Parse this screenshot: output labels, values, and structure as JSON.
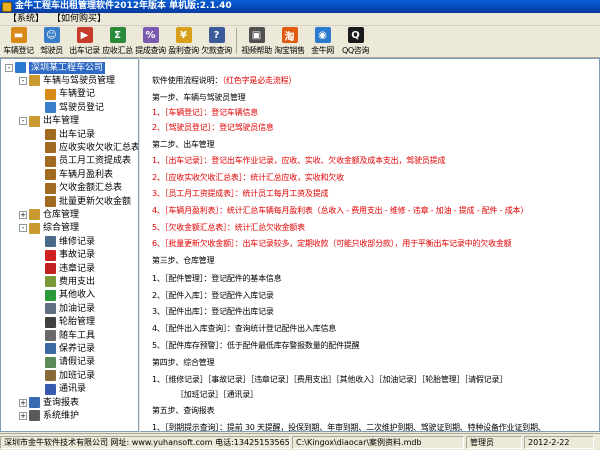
{
  "window": {
    "title": "金牛工程车出租管理软件2012年版本 单机版:2.1.40"
  },
  "menu": [
    "【系统】",
    "【如何购买】"
  ],
  "toolbar": [
    {
      "label": "车辆登记",
      "icon": "truck-icon",
      "color": "#d88a18"
    },
    {
      "label": "驾驶员",
      "icon": "driver-icon",
      "color": "#3a7dc8"
    },
    {
      "label": "出车记录",
      "icon": "dispatch-icon",
      "color": "#c83a2a"
    },
    {
      "label": "应收汇总",
      "icon": "summary-icon",
      "color": "#2a8a3a"
    },
    {
      "label": "提成查询",
      "icon": "commission-icon",
      "color": "#7a5ab0"
    },
    {
      "label": "盈利查询",
      "icon": "profit-icon",
      "color": "#d8a018"
    },
    {
      "label": "欠款查询",
      "icon": "debt-icon",
      "color": "#3a5a9a"
    },
    {
      "label": "视频帮助",
      "icon": "video-icon",
      "color": "#505050"
    },
    {
      "label": "淘宝销售",
      "icon": "taobao-icon",
      "color": "#e05a10"
    },
    {
      "label": "金牛网",
      "icon": "globe-icon",
      "color": "#2a7ad0"
    },
    {
      "label": "QQ咨询",
      "icon": "qq-icon",
      "color": "#1a1a1a"
    }
  ],
  "tree": [
    {
      "label": "深圳某工程车公司",
      "level": 0,
      "icon": "company-icon",
      "color": "#2a7ad0",
      "exp": "-",
      "selected": true
    },
    {
      "label": "车辆与驾驶员管理",
      "level": 1,
      "icon": "folder-icon",
      "color": "#c89a30",
      "exp": "-"
    },
    {
      "label": "车辆登记",
      "level": 2,
      "icon": "truck-icon",
      "color": "#d88a18"
    },
    {
      "label": "驾驶员登记",
      "level": 2,
      "icon": "driver-icon",
      "color": "#3a7dc8"
    },
    {
      "label": "出车管理",
      "level": 1,
      "icon": "folder-icon",
      "color": "#c89a30",
      "exp": "-"
    },
    {
      "label": "出车记录",
      "level": 2,
      "icon": "doc-icon",
      "color": "#a06a20"
    },
    {
      "label": "应收实收欠收汇总表",
      "level": 2,
      "icon": "doc-icon",
      "color": "#a06a20"
    },
    {
      "label": "员工月工资提成表",
      "level": 2,
      "icon": "doc-icon",
      "color": "#a06a20"
    },
    {
      "label": "车辆月盈利表",
      "level": 2,
      "icon": "doc-icon",
      "color": "#a06a20"
    },
    {
      "label": "欠收金额汇总表",
      "level": 2,
      "icon": "doc-icon",
      "color": "#a06a20"
    },
    {
      "label": "批量更新欠收金额",
      "level": 2,
      "icon": "doc-icon",
      "color": "#a06a20"
    },
    {
      "label": "仓库管理",
      "level": 1,
      "icon": "folder-icon",
      "color": "#c89a30",
      "exp": "+"
    },
    {
      "label": "综合管理",
      "level": 1,
      "icon": "folder-icon",
      "color": "#c89a30",
      "exp": "-"
    },
    {
      "label": "维修记录",
      "level": 2,
      "icon": "wrench-icon",
      "color": "#4a6a8a"
    },
    {
      "label": "事故记录",
      "level": 2,
      "icon": "accident-icon",
      "color": "#d02020"
    },
    {
      "label": "违章记录",
      "level": 2,
      "icon": "violation-icon",
      "color": "#c02020"
    },
    {
      "label": "费用支出",
      "level": 2,
      "icon": "expense-icon",
      "color": "#7a9a3a"
    },
    {
      "label": "其他收入",
      "level": 2,
      "icon": "income-icon",
      "color": "#2a9a3a"
    },
    {
      "label": "加油记录",
      "level": 2,
      "icon": "fuel-icon",
      "color": "#607080"
    },
    {
      "label": "轮胎管理",
      "level": 2,
      "icon": "tire-icon",
      "color": "#404040"
    },
    {
      "label": "随车工具",
      "level": 2,
      "icon": "tool-icon",
      "color": "#6a6a6a"
    },
    {
      "label": "保养记录",
      "level": 2,
      "icon": "gear-icon",
      "color": "#3a6aa0"
    },
    {
      "label": "请假记录",
      "level": 2,
      "icon": "leave-icon",
      "color": "#5a8a5a"
    },
    {
      "label": "加班记录",
      "level": 2,
      "icon": "overtime-icon",
      "color": "#8a6a3a"
    },
    {
      "label": "通讯录",
      "level": 2,
      "icon": "contacts-icon",
      "color": "#3a5ab0"
    },
    {
      "label": "查询报表",
      "level": 1,
      "icon": "report-icon",
      "color": "#3a6ab0",
      "exp": "+"
    },
    {
      "label": "系统维护",
      "level": 1,
      "icon": "system-icon",
      "color": "#5a5a5a",
      "exp": "+"
    }
  ],
  "content": {
    "lines": [
      {
        "segments": [
          {
            "t": "软件使用流程说明：",
            "c": ""
          },
          {
            "t": "（红色字是必走流程）",
            "c": "red"
          }
        ],
        "indent": 0
      },
      {
        "segments": [
          {
            "t": "第一步、车辆与驾驶员管理",
            "c": ""
          }
        ],
        "indent": 0
      },
      {
        "segments": [
          {
            "t": "1、［车辆登记］：登记车辆信息",
            "c": "red"
          }
        ],
        "indent": 0
      },
      {
        "segments": [
          {
            "t": "2、［驾驶员登记］：登记驾驶员信息",
            "c": "red"
          }
        ],
        "indent": 0
      },
      {
        "segments": [
          {
            "t": "第二步、出车管理",
            "c": ""
          }
        ],
        "indent": 0
      },
      {
        "segments": [
          {
            "t": "1、［出车记录］：登记出车作业记录，应收、实收、欠收金额及成本支出，驾驶员提成",
            "c": "red"
          }
        ],
        "indent": 0
      },
      {
        "segments": [
          {
            "t": "2、［应收实收欠收汇总表］：统计汇总应收，实收和欠收",
            "c": "red"
          }
        ],
        "indent": 0
      },
      {
        "segments": [
          {
            "t": "3、［员工月工资提成表］：统计员工每月工资及提成",
            "c": "red"
          }
        ],
        "indent": 0
      },
      {
        "segments": [
          {
            "t": "4、［车辆月盈利表］：统计汇总车辆每月盈利表（总收入 - 费用支出 - 维修 - 违章 - 加油 - 提成 - 配件 - 成本）",
            "c": "red"
          }
        ],
        "indent": 0
      },
      {
        "segments": [
          {
            "t": "5、［欠收金额汇总表］：统计汇总欠收金额表",
            "c": "red"
          }
        ],
        "indent": 0
      },
      {
        "segments": [
          {
            "t": "6、［批量更新欠收金额］：出车记录较多，定期收款（可能只收部分款），用于平衡出车记录中的欠收金额",
            "c": "red"
          }
        ],
        "indent": 0
      },
      {
        "segments": [
          {
            "t": "第三步、仓库管理",
            "c": ""
          }
        ],
        "indent": 0
      },
      {
        "segments": [
          {
            "t": "1、［配件管理］：登记配件的基本信息",
            "c": ""
          }
        ],
        "indent": 0
      },
      {
        "segments": [
          {
            "t": "2、［配件入库］：登记配件入库记录",
            "c": ""
          }
        ],
        "indent": 0
      },
      {
        "segments": [
          {
            "t": "3、［配件出库］：登记配件出库记录",
            "c": ""
          }
        ],
        "indent": 0
      },
      {
        "segments": [
          {
            "t": "4、［配件出入库查询］：查询统计登记配件出入库信息",
            "c": ""
          }
        ],
        "indent": 0
      },
      {
        "segments": [
          {
            "t": "5、［配件库存预警］：低于配件最低库存警报数量的配件提醒",
            "c": ""
          }
        ],
        "indent": 0
      },
      {
        "segments": [
          {
            "t": "第四步、综合管理",
            "c": ""
          }
        ],
        "indent": 0
      },
      {
        "segments": [
          {
            "t": "1、［维修记录］［事故记录］［违章记录］［费用支出］［其他收入］［加油记录］［轮胎管理］［请假记录］",
            "c": ""
          }
        ],
        "indent": 0
      },
      {
        "segments": [
          {
            "t": "［加班记录］［通讯录］",
            "c": ""
          }
        ],
        "indent": 1
      },
      {
        "segments": [
          {
            "t": "第五步、查询报表",
            "c": ""
          }
        ],
        "indent": 0
      },
      {
        "segments": [
          {
            "t": "1、［到期提示查询］：提前 30 天提醒，投保到期、年审到期、二次维护到期、驾驶证到期、特种设备作业证到期、",
            "c": ""
          }
        ],
        "indent": 0
      },
      {
        "segments": [
          {
            "t": "道路运输作业证到期、配件库存警报",
            "c": ""
          }
        ],
        "indent": 2
      }
    ]
  },
  "status": {
    "company": "深圳市金牛软件技术有限公司 网址: www.yuhansoft.com 电话:13425153565 QQ:21035391",
    "path": "C:\\Kingox\\diaocar\\案例资料.mdb",
    "user": "管理员",
    "date": "2012-2-22"
  }
}
